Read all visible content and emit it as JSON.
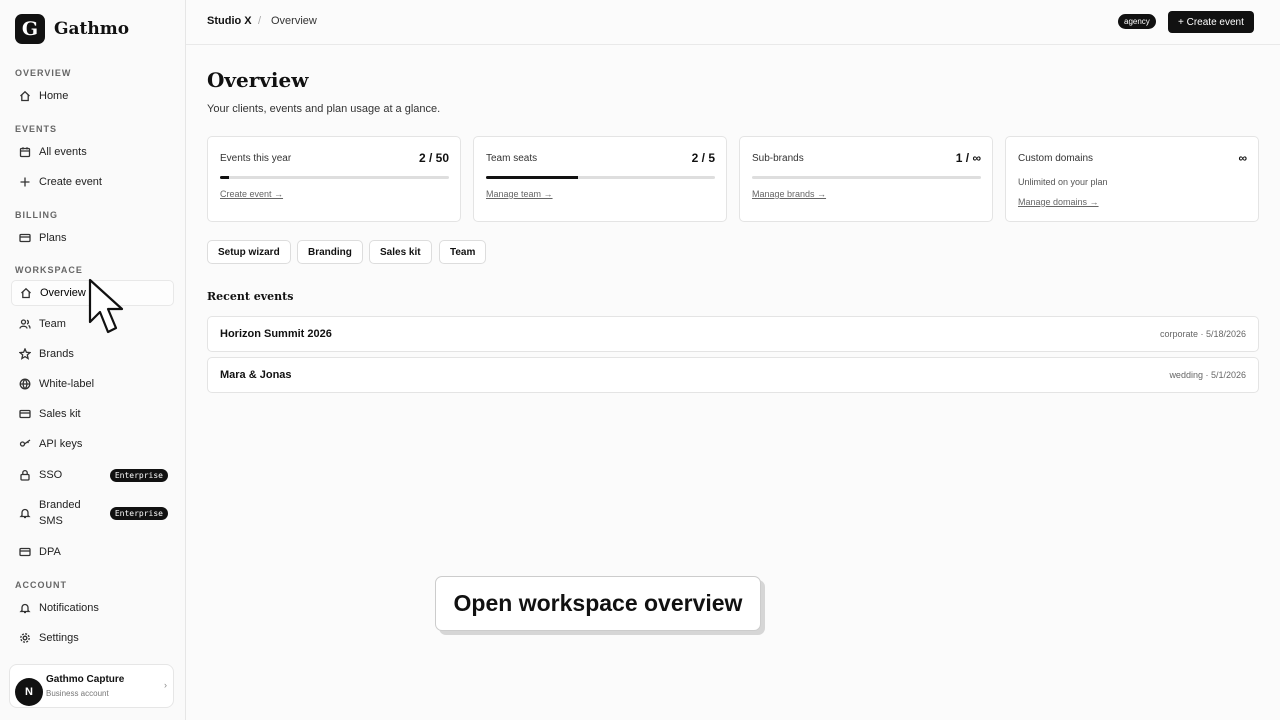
{
  "brand": {
    "logo_letter": "G",
    "name": "Gathmo"
  },
  "sidebar": {
    "sections": [
      {
        "title": "OVERVIEW"
      },
      {
        "title": "EVENTS"
      },
      {
        "title": "BILLING"
      },
      {
        "title": "WORKSPACE"
      },
      {
        "title": "ACCOUNT"
      }
    ],
    "items": {
      "home": "Home",
      "all_events": "All events",
      "create_event": "Create event",
      "plans": "Plans",
      "overview": "Overview",
      "team": "Team",
      "brands": "Brands",
      "white_label": "White-label",
      "sales_kit": "Sales kit",
      "api_keys": "API keys",
      "sso": "SSO",
      "branded_sms": "Branded SMS",
      "dpa": "DPA",
      "notifications": "Notifications",
      "settings": "Settings"
    },
    "enterprise_badge": "Enterprise",
    "active_item": "overview"
  },
  "account": {
    "avatar_letter": "N",
    "name": "Gathmo Capture",
    "type": "Business account",
    "chevron": "›"
  },
  "topbar": {
    "breadcrumb_root": "Studio X",
    "breadcrumb_sep": "/",
    "breadcrumb_page": "Overview",
    "plan_pill": "agency",
    "create_button": "+ Create event"
  },
  "main": {
    "title": "Overview",
    "subtitle": "Your clients, events and plan usage at a glance.",
    "stats": [
      {
        "label": "Events this year",
        "value": "2 / 50",
        "fraction": 0.04,
        "link": "Create event →"
      },
      {
        "label": "Team seats",
        "value": "2 / 5",
        "fraction": 0.4,
        "link": "Manage team →"
      },
      {
        "label": "Sub-brands",
        "value": "1 / ∞",
        "fraction": 0.0,
        "link": "Manage brands →"
      },
      {
        "label": "Custom domains",
        "value": "∞",
        "note": "Unlimited on your plan",
        "link": "Manage domains →"
      }
    ],
    "chips": [
      "Setup wizard",
      "Branding",
      "Sales kit",
      "Team"
    ],
    "recent_title": "Recent events",
    "events": [
      {
        "name": "Horizon Summit 2026",
        "meta": "corporate · 5/18/2026"
      },
      {
        "name": "Mara & Jonas",
        "meta": "wedding · 5/1/2026"
      }
    ]
  },
  "caption": "Open workspace overview",
  "colors": {
    "accent": "#111111",
    "background": "#fbfbfb",
    "border": "#e4e4e4"
  }
}
